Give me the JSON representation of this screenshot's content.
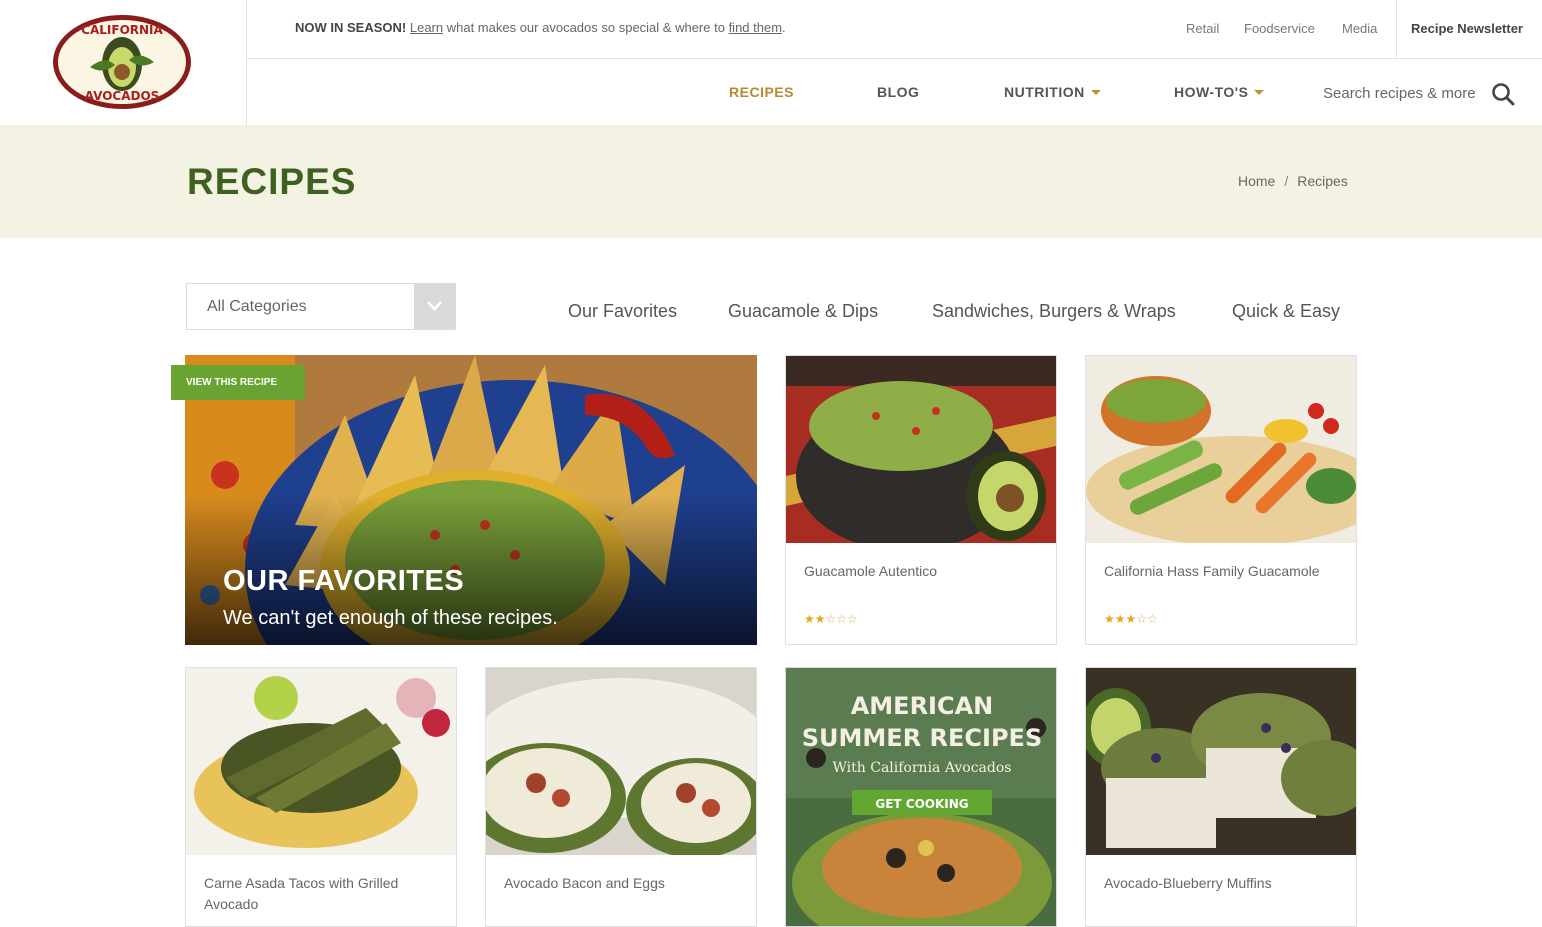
{
  "header": {
    "logo_text_top": "CALIFORNIA",
    "logo_text_bottom": "AVOCADOS",
    "season_bold": "NOW IN SEASON!",
    "season_link1": "Learn",
    "season_mid": "what makes our avocados so special & where to",
    "season_link2": "find them",
    "season_end": ".",
    "util_links": [
      "Retail",
      "Foodservice",
      "Media"
    ],
    "newsletter": "Recipe Newsletter",
    "nav": [
      {
        "label": "RECIPES",
        "active": true
      },
      {
        "label": "BLOG"
      },
      {
        "label": "NUTRITION",
        "dropdown": true
      },
      {
        "label": "HOW-TO'S",
        "dropdown": true
      }
    ],
    "search_placeholder": "Search recipes & more"
  },
  "banner": {
    "title": "RECIPES",
    "breadcrumb": [
      "Home",
      "/",
      "Recipes"
    ]
  },
  "filters": {
    "select_value": "All Categories",
    "tabs": [
      "Our Favorites",
      "Guacamole & Dips",
      "Sandwiches, Burgers & Wraps",
      "Quick & Easy"
    ]
  },
  "feature": {
    "tag": "VIEW THIS RECIPE",
    "title": "OUR FAVORITES",
    "subtitle": "We can't get enough of these recipes."
  },
  "cards": [
    {
      "title": "Guacamole Autentico",
      "rating": 2,
      "max": 5
    },
    {
      "title": "California Hass Family Guacamole",
      "rating": 3,
      "max": 5
    },
    {
      "title": "Carne Asada Tacos with Grilled Avocado"
    },
    {
      "title": "Avocado Bacon and Eggs"
    },
    {
      "title": "AMERICAN SUMMER RECIPES",
      "promo_line1": "AMERICAN",
      "promo_line2": "SUMMER RECIPES",
      "promo_sub": "With California Avocados",
      "promo_button": "GET COOKING"
    },
    {
      "title": "Avocado-Blueberry Muffins"
    }
  ],
  "colors": {
    "brand_green": "#3e6122",
    "accent_gold": "#b9882f",
    "tag_green": "#6aa332",
    "banner_bg": "#f4f2e2",
    "star": "#e7a51b"
  }
}
